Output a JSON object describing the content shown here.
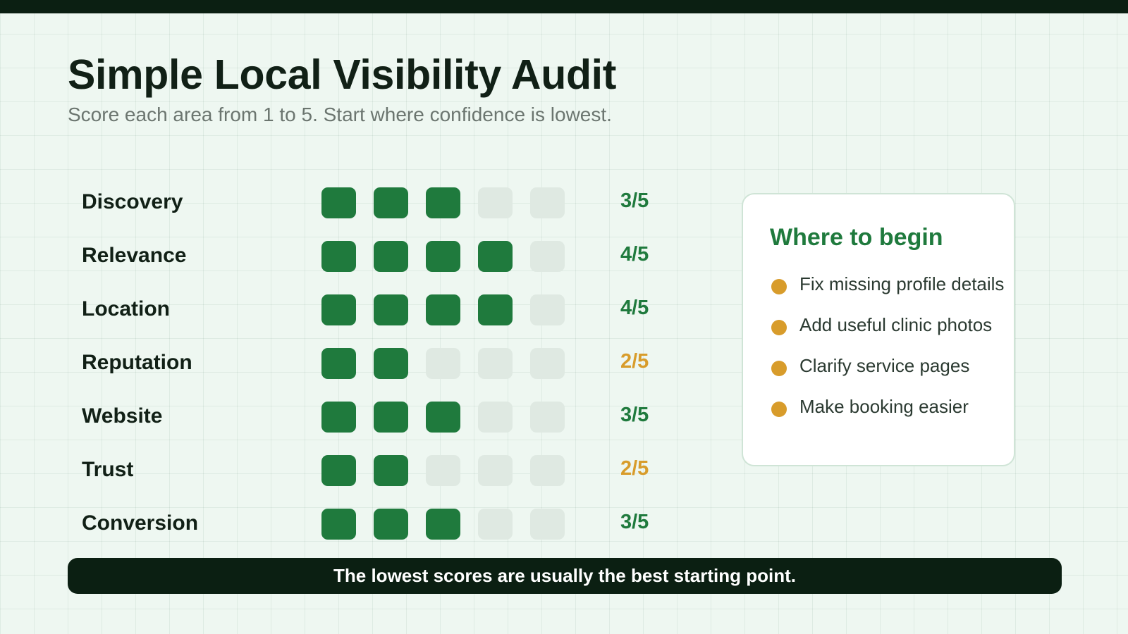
{
  "header": {
    "title": "Simple Local Visibility Audit",
    "subtitle": "Score each area from 1 to 5. Start where confidence is lowest."
  },
  "scale_max": 5,
  "colors": {
    "filled": "#1f7a3d",
    "empty": "#dfe9e2",
    "good_score": "#1f7a3d",
    "low_score": "#d89c2b",
    "dark": "#0b1f12"
  },
  "scores": [
    {
      "label": "Discovery",
      "value": 3,
      "score_text": "3/5",
      "low": false
    },
    {
      "label": "Relevance",
      "value": 4,
      "score_text": "4/5",
      "low": false
    },
    {
      "label": "Location",
      "value": 4,
      "score_text": "4/5",
      "low": false
    },
    {
      "label": "Reputation",
      "value": 2,
      "score_text": "2/5",
      "low": true
    },
    {
      "label": "Website",
      "value": 3,
      "score_text": "3/5",
      "low": false
    },
    {
      "label": "Trust",
      "value": 2,
      "score_text": "2/5",
      "low": true
    },
    {
      "label": "Conversion",
      "value": 3,
      "score_text": "3/5",
      "low": false
    }
  ],
  "sidebar": {
    "title": "Where to begin",
    "items": [
      "Fix missing profile details",
      "Add useful clinic photos",
      "Clarify service pages",
      "Make booking easier"
    ]
  },
  "footer": {
    "text": "The lowest scores are usually the best starting point."
  }
}
